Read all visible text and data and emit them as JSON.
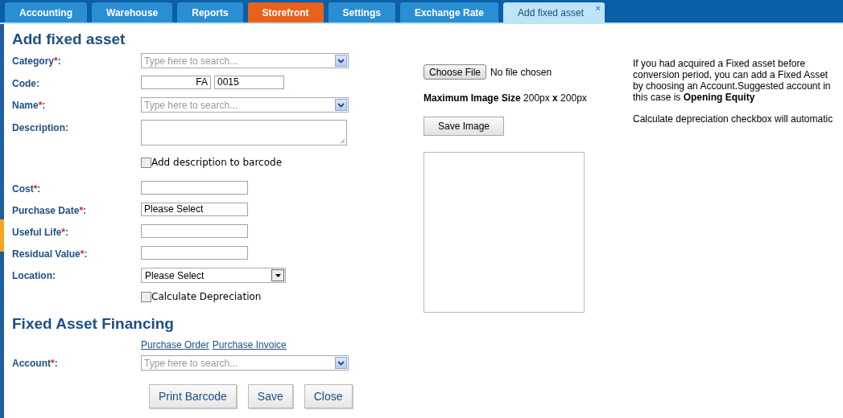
{
  "tabs": [
    {
      "label": "Accounting",
      "selected": false,
      "highlighted": false
    },
    {
      "label": "Warehouse",
      "selected": false,
      "highlighted": false
    },
    {
      "label": "Reports",
      "selected": false,
      "highlighted": false
    },
    {
      "label": "Storefront",
      "selected": false,
      "highlighted": true
    },
    {
      "label": "Settings",
      "selected": false,
      "highlighted": false
    },
    {
      "label": "Exchange Rate",
      "selected": false,
      "highlighted": false
    },
    {
      "label": "Add fixed asset",
      "selected": true,
      "highlighted": false,
      "close": "×"
    }
  ],
  "title": "Add fixed asset",
  "fields": [
    {
      "kind": "combo",
      "label": "Category",
      "required_mark": "*",
      "colon": ":",
      "placeholder": "Type here to search..."
    },
    {
      "kind": "code",
      "label": "Code",
      "colon": ":",
      "prefix": "FA",
      "value": "0015"
    },
    {
      "kind": "combo",
      "label": "Name",
      "required_mark": "*",
      "colon": ":",
      "placeholder": "Type here to search..."
    },
    {
      "kind": "textarea",
      "label": "Description",
      "colon": ":"
    },
    {
      "kind": "checkbox",
      "text": "Add description to barcode",
      "checked": false
    },
    {
      "kind": "text",
      "label": "Cost",
      "required_mark": "*",
      "colon": ":"
    },
    {
      "kind": "text",
      "label": "Purchase Date",
      "required_mark": "*",
      "colon": ":",
      "value": "Please Select"
    },
    {
      "kind": "text",
      "label": "Useful Life",
      "required_mark": "*",
      "colon": ":"
    },
    {
      "kind": "text",
      "label": "Residual Value",
      "required_mark": "*",
      "colon": ":"
    },
    {
      "kind": "select",
      "label": "Location",
      "colon": ":",
      "value": "Please Select"
    },
    {
      "kind": "checkbox",
      "text": "Calculate Depreciation",
      "checked": false
    }
  ],
  "financing": {
    "title": "Fixed Asset Financing",
    "links": [
      "Purchase Order",
      "Purchase Invoice"
    ],
    "account": {
      "label": "Account",
      "required_mark": "*",
      "colon": ":",
      "placeholder": "Type here to search..."
    }
  },
  "buttons": [
    "Print Barcode",
    "Save",
    "Close"
  ],
  "image": {
    "choose_button": "Choose File",
    "file_status": "No file chosen",
    "size_note": "**Maximum Image Size** 200px **x** 200px",
    "save_button": "Save Image"
  },
  "help": [
    "If you had acquired a Fixed asset before conversion period, you can add a Fixed Asset by choosing an Account.Suggested account in this case is **Opening Equity**",
    "Calculate depreciation checkbox will automatic"
  ]
}
